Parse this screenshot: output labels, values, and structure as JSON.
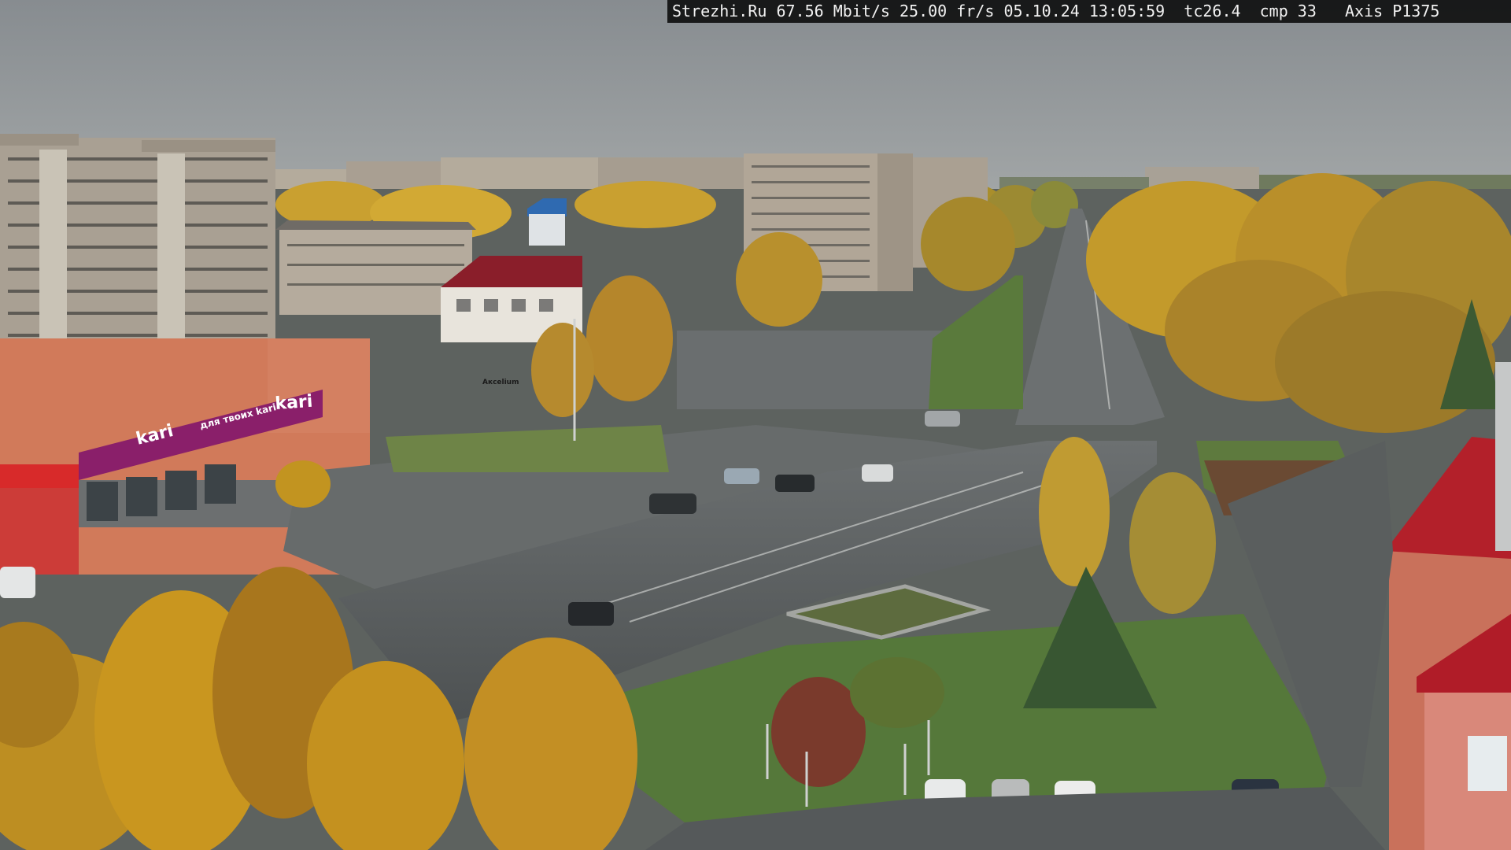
{
  "overlay": {
    "site": "Strezhi.Ru",
    "bitrate": "67.56 Mbit/s",
    "framerate": "25.00 fr/s",
    "date": "05.10.24",
    "time": "13:05:59",
    "tc": "tc26.4",
    "cmp": "cmp 33",
    "camera": "Axis P1375"
  },
  "signs": {
    "store_brand": "kari",
    "store_slogan": "для твоих kari",
    "store_side": "kari",
    "shop_small": "Акcelium"
  },
  "colors": {
    "sky": "#8e9396",
    "asphalt": "#565a5b",
    "grass": "#5f7d3c",
    "birch_yellow": "#c89a2a",
    "store_purple": "#8a1f6a",
    "roof_red": "#b3202a"
  }
}
